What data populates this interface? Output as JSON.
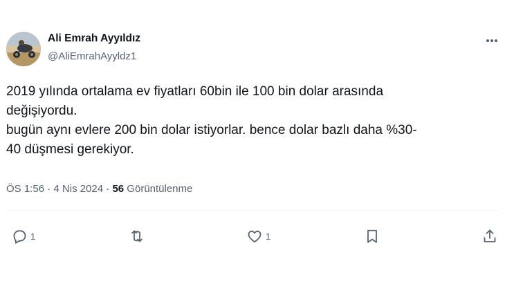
{
  "author": {
    "name": "Ali Emrah Ayyıldız",
    "handle": "@AliEmrahAyyldz1",
    "avatar_icon": "profile-photo"
  },
  "tweet": {
    "lines": [
      "2019 yılında ortalama ev fiyatları 60bin ile 100 bin dolar arasında",
      "değişiyordu.",
      "bugün aynı evlere 200 bin dolar istiyorlar. bence dolar bazlı daha %30-",
      "40 düşmesi gerekiyor."
    ]
  },
  "meta": {
    "time": "ÖS 1:56",
    "separator1": " · ",
    "date": "4 Nis 2024",
    "separator2": " · ",
    "views_count": "56",
    "views_label": " Görüntülenme"
  },
  "actions": {
    "reply": {
      "icon": "reply-icon",
      "count": "1"
    },
    "retweet": {
      "icon": "retweet-icon",
      "count": ""
    },
    "like": {
      "icon": "heart-icon",
      "count": "1"
    },
    "bookmark": {
      "icon": "bookmark-icon",
      "count": ""
    },
    "share": {
      "icon": "share-icon",
      "count": ""
    }
  },
  "colors": {
    "text_primary": "#0f1419",
    "text_secondary": "#536471",
    "divider": "#eff3f4"
  }
}
